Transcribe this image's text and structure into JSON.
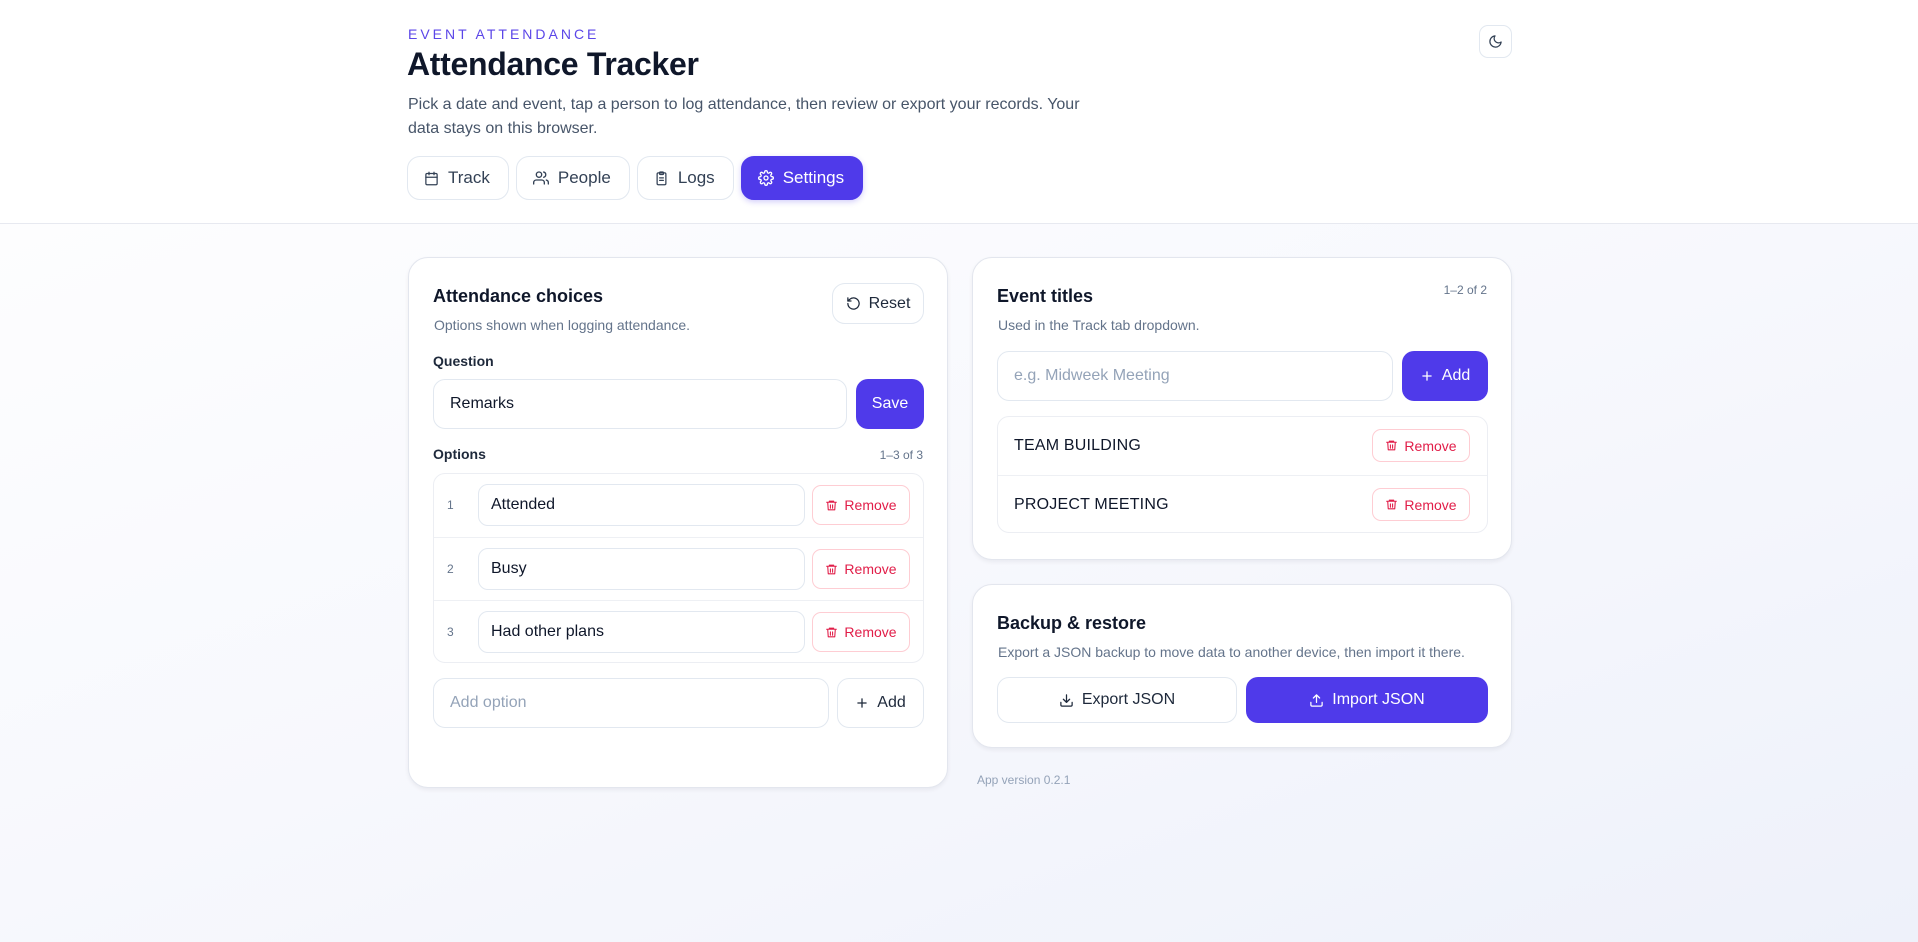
{
  "header": {
    "eyebrow": "EVENT ATTENDANCE",
    "title": "Attendance Tracker",
    "subtitle": "Pick a date and event, tap a person to log attendance, then review or export your records. Your data stays on this browser."
  },
  "tabs": [
    {
      "label": "Track",
      "icon": "calendar-icon"
    },
    {
      "label": "People",
      "icon": "users-icon"
    },
    {
      "label": "Logs",
      "icon": "clipboard-icon"
    },
    {
      "label": "Settings",
      "icon": "gear-icon",
      "active": true
    }
  ],
  "attendance": {
    "title": "Attendance choices",
    "subtitle": "Options shown when logging attendance.",
    "reset_label": "Reset",
    "question_label": "Question",
    "question_value": "Remarks",
    "save_label": "Save",
    "options_label": "Options",
    "options_count": "1–3 of 3",
    "options": [
      {
        "num": "1",
        "value": "Attended"
      },
      {
        "num": "2",
        "value": "Busy"
      },
      {
        "num": "3",
        "value": "Had other plans"
      }
    ],
    "remove_label": "Remove",
    "add_placeholder": "Add option",
    "add_label": "Add"
  },
  "events": {
    "title": "Event titles",
    "subtitle": "Used in the Track tab dropdown.",
    "count": "1–2 of 2",
    "input_placeholder": "e.g. Midweek Meeting",
    "add_label": "Add",
    "items": [
      "TEAM BUILDING",
      "PROJECT MEETING"
    ],
    "remove_label": "Remove"
  },
  "backup": {
    "title": "Backup & restore",
    "subtitle": "Export a JSON backup to move data to another device, then import it there.",
    "export_label": "Export JSON",
    "import_label": "Import JSON"
  },
  "footer": {
    "version": "App version 0.2.1"
  },
  "colors": {
    "accent": "#4f3aea",
    "danger": "#e11d48"
  }
}
